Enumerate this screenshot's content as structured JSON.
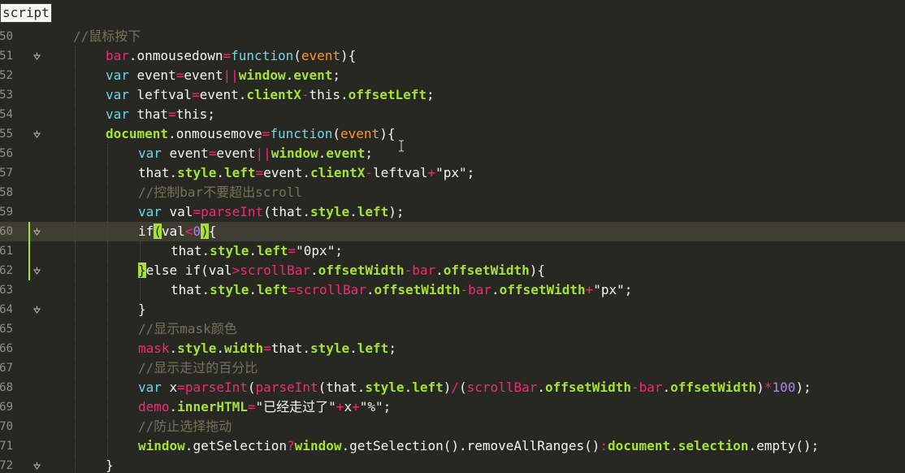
{
  "tab": {
    "label": "script"
  },
  "colors": {
    "background": "#272822",
    "current_line": "#3e3d32",
    "keyword": "#f92672",
    "storage": "#66d9ef",
    "global_object": "#a6e22e",
    "function": "#66d9ef",
    "parameter": "#fd971f",
    "string": "#e6db74",
    "number": "#ae81ff",
    "comment": "#75715e",
    "plain": "#f8f8f2",
    "line_number": "#90908a"
  },
  "lines": [
    {
      "num": "50",
      "fold": false,
      "tokens": [
        [
          "//鼠标按下",
          "cm"
        ]
      ]
    },
    {
      "num": "51",
      "fold": true,
      "tokens": [
        [
          "bar",
          "kw"
        ],
        [
          ".",
          "pl"
        ],
        [
          "onmousedown",
          "pl"
        ],
        [
          "=",
          "op"
        ],
        [
          "function",
          "fn"
        ],
        [
          "(",
          "br"
        ],
        [
          "event",
          "pr"
        ],
        [
          "){",
          "br"
        ]
      ]
    },
    {
      "num": "52",
      "fold": false,
      "tokens": [
        [
          "var ",
          "st"
        ],
        [
          "event",
          "pl"
        ],
        [
          "=",
          "op"
        ],
        [
          "event",
          "pl"
        ],
        [
          "||",
          "op"
        ],
        [
          "window",
          "gn"
        ],
        [
          ".",
          "pl"
        ],
        [
          "event",
          "gn"
        ],
        [
          ";",
          "pl"
        ]
      ]
    },
    {
      "num": "53",
      "fold": false,
      "tokens": [
        [
          "var ",
          "st"
        ],
        [
          "leftval",
          "pl"
        ],
        [
          "=",
          "op"
        ],
        [
          "event",
          "pl"
        ],
        [
          ".",
          "pl"
        ],
        [
          "clientX",
          "gn"
        ],
        [
          "-",
          "op"
        ],
        [
          "this",
          "pl"
        ],
        [
          ".",
          "pl"
        ],
        [
          "offsetLeft",
          "gn"
        ],
        [
          ";",
          "pl"
        ]
      ]
    },
    {
      "num": "54",
      "fold": false,
      "tokens": [
        [
          "var ",
          "st"
        ],
        [
          "that",
          "pl"
        ],
        [
          "=",
          "op"
        ],
        [
          "this",
          "pl"
        ],
        [
          ";",
          "pl"
        ]
      ]
    },
    {
      "num": "55",
      "fold": true,
      "tokens": [
        [
          "document",
          "gn"
        ],
        [
          ".",
          "pl"
        ],
        [
          "onmousemove",
          "pl"
        ],
        [
          "=",
          "op"
        ],
        [
          "function",
          "fn"
        ],
        [
          "(",
          "br"
        ],
        [
          "event",
          "pr"
        ],
        [
          ")",
          "br"
        ],
        [
          "{",
          "br"
        ]
      ]
    },
    {
      "num": "56",
      "fold": false,
      "tokens": [
        [
          "var ",
          "st"
        ],
        [
          "event",
          "pl"
        ],
        [
          "=",
          "op"
        ],
        [
          "event",
          "pl"
        ],
        [
          "||",
          "op"
        ],
        [
          "window",
          "gn"
        ],
        [
          ".",
          "pl"
        ],
        [
          "event",
          "gn"
        ],
        [
          ";",
          "pl"
        ]
      ]
    },
    {
      "num": "57",
      "fold": false,
      "tokens": [
        [
          "that",
          "pl"
        ],
        [
          ".",
          "pl"
        ],
        [
          "style",
          "gn"
        ],
        [
          ".",
          "pl"
        ],
        [
          "left",
          "gn"
        ],
        [
          "=",
          "op"
        ],
        [
          "event",
          "pl"
        ],
        [
          ".",
          "pl"
        ],
        [
          "clientX",
          "gn"
        ],
        [
          "-",
          "op"
        ],
        [
          "leftval",
          "pl"
        ],
        [
          "+",
          "op"
        ],
        [
          "\"px\"",
          "str2"
        ],
        [
          ";",
          "pl"
        ]
      ]
    },
    {
      "num": "58",
      "fold": false,
      "tokens": [
        [
          "//控制bar不要超出scroll",
          "cm"
        ]
      ]
    },
    {
      "num": "59",
      "fold": false,
      "tokens": [
        [
          "var ",
          "st"
        ],
        [
          "val",
          "pl"
        ],
        [
          "=",
          "op"
        ],
        [
          "parseInt",
          "kw"
        ],
        [
          "(",
          "br"
        ],
        [
          "that",
          "pl"
        ],
        [
          ".",
          "pl"
        ],
        [
          "style",
          "gn"
        ],
        [
          ".",
          "pl"
        ],
        [
          "left",
          "gn"
        ],
        [
          ");",
          "br"
        ]
      ]
    },
    {
      "num": "60",
      "fold": true,
      "current": true,
      "tokens": [
        [
          "if",
          "pl"
        ],
        [
          "(",
          "hl"
        ],
        [
          "val",
          "pl"
        ],
        [
          "<",
          "op"
        ],
        [
          "0",
          "num"
        ],
        [
          ")",
          "hl"
        ],
        [
          "{",
          "br"
        ]
      ]
    },
    {
      "num": "61",
      "fold": false,
      "tokens": [
        [
          "that",
          "pl"
        ],
        [
          ".",
          "pl"
        ],
        [
          "style",
          "gn"
        ],
        [
          ".",
          "pl"
        ],
        [
          "left",
          "gn"
        ],
        [
          "=",
          "op"
        ],
        [
          "\"0px\"",
          "str2"
        ],
        [
          ";",
          "pl"
        ]
      ]
    },
    {
      "num": "62",
      "fold": true,
      "tokens": [
        [
          "}",
          "hl"
        ],
        [
          "else if",
          "pl"
        ],
        [
          "(",
          "br"
        ],
        [
          "val",
          "pl"
        ],
        [
          ">",
          "op"
        ],
        [
          "scrollBar",
          "kw"
        ],
        [
          ".",
          "pl"
        ],
        [
          "offsetWidth",
          "gn"
        ],
        [
          "-",
          "op"
        ],
        [
          "bar",
          "kw"
        ],
        [
          ".",
          "pl"
        ],
        [
          "offsetWidth",
          "gn"
        ],
        [
          "){",
          "br"
        ]
      ]
    },
    {
      "num": "63",
      "fold": false,
      "tokens": [
        [
          "that",
          "pl"
        ],
        [
          ".",
          "pl"
        ],
        [
          "style",
          "gn"
        ],
        [
          ".",
          "pl"
        ],
        [
          "left",
          "gn"
        ],
        [
          "=",
          "op"
        ],
        [
          "scrollBar",
          "kw"
        ],
        [
          ".",
          "pl"
        ],
        [
          "offsetWidth",
          "gn"
        ],
        [
          "-",
          "op"
        ],
        [
          "bar",
          "kw"
        ],
        [
          ".",
          "pl"
        ],
        [
          "offsetWidth",
          "gn"
        ],
        [
          "+",
          "op"
        ],
        [
          "\"px\"",
          "str2"
        ],
        [
          ";",
          "pl"
        ]
      ]
    },
    {
      "num": "64",
      "fold": true,
      "tokens": [
        [
          "}",
          "br"
        ]
      ]
    },
    {
      "num": "65",
      "fold": false,
      "tokens": [
        [
          "//显示mask颜色",
          "cm"
        ]
      ]
    },
    {
      "num": "66",
      "fold": false,
      "tokens": [
        [
          "mask",
          "kw"
        ],
        [
          ".",
          "pl"
        ],
        [
          "style",
          "gn"
        ],
        [
          ".",
          "pl"
        ],
        [
          "width",
          "gn"
        ],
        [
          "=",
          "op"
        ],
        [
          "that",
          "pl"
        ],
        [
          ".",
          "pl"
        ],
        [
          "style",
          "gn"
        ],
        [
          ".",
          "pl"
        ],
        [
          "left",
          "gn"
        ],
        [
          ";",
          "pl"
        ]
      ]
    },
    {
      "num": "67",
      "fold": false,
      "tokens": [
        [
          "//显示走过的百分比",
          "cm"
        ]
      ]
    },
    {
      "num": "68",
      "fold": false,
      "tokens": [
        [
          "var ",
          "st"
        ],
        [
          "x",
          "pl"
        ],
        [
          "=",
          "op"
        ],
        [
          "parseInt",
          "kw"
        ],
        [
          "(",
          "br"
        ],
        [
          "parseInt",
          "kw"
        ],
        [
          "(",
          "br"
        ],
        [
          "that",
          "pl"
        ],
        [
          ".",
          "pl"
        ],
        [
          "style",
          "gn"
        ],
        [
          ".",
          "pl"
        ],
        [
          "left",
          "gn"
        ],
        [
          ")",
          "br"
        ],
        [
          "/",
          "op"
        ],
        [
          "(",
          "br"
        ],
        [
          "scrollBar",
          "kw"
        ],
        [
          ".",
          "pl"
        ],
        [
          "offsetWidth",
          "gn"
        ],
        [
          "-",
          "op"
        ],
        [
          "bar",
          "kw"
        ],
        [
          ".",
          "pl"
        ],
        [
          "offsetWidth",
          "gn"
        ],
        [
          ")",
          "br"
        ],
        [
          "*",
          "op"
        ],
        [
          "100",
          "num"
        ],
        [
          ");",
          "br"
        ]
      ]
    },
    {
      "num": "69",
      "fold": false,
      "tokens": [
        [
          "demo",
          "kw"
        ],
        [
          ".",
          "pl"
        ],
        [
          "innerHTML",
          "gn"
        ],
        [
          "=",
          "op"
        ],
        [
          "\"已经走过了\"",
          "str2"
        ],
        [
          "+",
          "op"
        ],
        [
          "x",
          "pl"
        ],
        [
          "+",
          "op"
        ],
        [
          "\"%\"",
          "str2"
        ],
        [
          ";",
          "pl"
        ]
      ]
    },
    {
      "num": "70",
      "fold": false,
      "tokens": [
        [
          "//防止选择拖动",
          "cm"
        ]
      ]
    },
    {
      "num": "71",
      "fold": false,
      "tokens": [
        [
          "window",
          "gn"
        ],
        [
          ".",
          "pl"
        ],
        [
          "getSelection",
          "pl"
        ],
        [
          "?",
          "op"
        ],
        [
          "window",
          "gn"
        ],
        [
          ".",
          "pl"
        ],
        [
          "getSelection",
          "pl"
        ],
        [
          "()",
          "br"
        ],
        [
          ".",
          "pl"
        ],
        [
          "removeAllRanges",
          "pl"
        ],
        [
          "()",
          "br"
        ],
        [
          ":",
          "op"
        ],
        [
          "document",
          "gn"
        ],
        [
          ".",
          "pl"
        ],
        [
          "selection",
          "gn"
        ],
        [
          ".",
          "pl"
        ],
        [
          "empty",
          "pl"
        ],
        [
          "();",
          "br"
        ]
      ]
    },
    {
      "num": "72",
      "fold": true,
      "tokens": [
        [
          "}",
          "br"
        ]
      ]
    }
  ]
}
